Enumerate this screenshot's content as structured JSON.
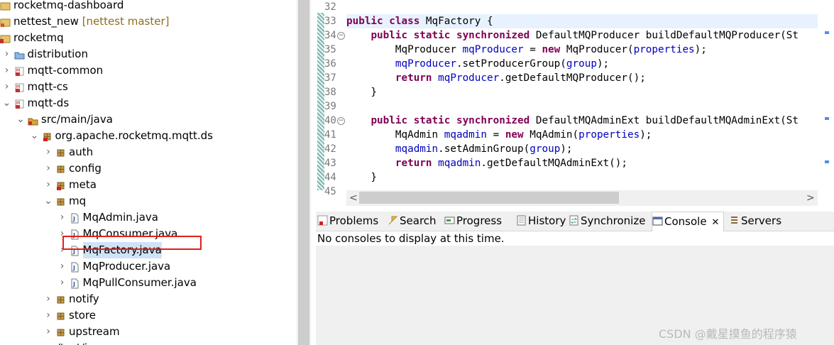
{
  "tree": {
    "rows": [
      {
        "label": "rocketmq-dashboard",
        "decor": "",
        "indent": 0,
        "twisty": "",
        "icon": "project"
      },
      {
        "label": "nettest_new",
        "decor": " [nettest master]",
        "indent": 0,
        "twisty": "",
        "icon": "git-project"
      },
      {
        "label": "rocketmq",
        "decor": "",
        "indent": 0,
        "twisty": "",
        "icon": "folder-project"
      },
      {
        "label": "distribution",
        "decor": "",
        "indent": 1,
        "twisty": ">",
        "icon": "folder"
      },
      {
        "label": "mqtt-common",
        "decor": "",
        "indent": 1,
        "twisty": ">",
        "icon": "maven-project"
      },
      {
        "label": "mqtt-cs",
        "decor": "",
        "indent": 1,
        "twisty": ">",
        "icon": "maven-project"
      },
      {
        "label": "mqtt-ds",
        "decor": "",
        "indent": 1,
        "twisty": "v",
        "icon": "maven-project"
      },
      {
        "label": "src/main/java",
        "decor": "",
        "indent": 2,
        "twisty": "v",
        "icon": "source-folder"
      },
      {
        "label": "org.apache.rocketmq.mqtt.ds",
        "decor": "",
        "indent": 3,
        "twisty": "v",
        "icon": "package-error"
      },
      {
        "label": "auth",
        "decor": "",
        "indent": 4,
        "twisty": ">",
        "icon": "package"
      },
      {
        "label": "config",
        "decor": "",
        "indent": 4,
        "twisty": ">",
        "icon": "package"
      },
      {
        "label": "meta",
        "decor": "",
        "indent": 4,
        "twisty": ">",
        "icon": "package-error"
      },
      {
        "label": "mq",
        "decor": "",
        "indent": 4,
        "twisty": "v",
        "icon": "package"
      },
      {
        "label": "MqAdmin.java",
        "decor": "",
        "indent": 5,
        "twisty": ">",
        "icon": "java-file"
      },
      {
        "label": "MqConsumer.java",
        "decor": "",
        "indent": 5,
        "twisty": ">",
        "icon": "java-file"
      },
      {
        "label": "MqFactory.java",
        "decor": "",
        "indent": 5,
        "twisty": ">",
        "icon": "java-file",
        "selected": true
      },
      {
        "label": "MqProducer.java",
        "decor": "",
        "indent": 5,
        "twisty": ">",
        "icon": "java-file"
      },
      {
        "label": "MqPullConsumer.java",
        "decor": "",
        "indent": 5,
        "twisty": ">",
        "icon": "java-file"
      },
      {
        "label": "notify",
        "decor": "",
        "indent": 4,
        "twisty": ">",
        "icon": "package"
      },
      {
        "label": "store",
        "decor": "",
        "indent": 4,
        "twisty": ">",
        "icon": "package"
      },
      {
        "label": "upstream",
        "decor": "",
        "indent": 4,
        "twisty": ">",
        "icon": "package"
      },
      {
        "label": "src/test/java",
        "decor": "",
        "indent": 2,
        "twisty": ">",
        "icon": "source-folder"
      }
    ]
  },
  "editor": {
    "lines": [
      {
        "n": "32",
        "html": ""
      },
      {
        "n": "33",
        "html": "<span class=\"kw\">public</span> <span class=\"kw\">class</span> MqFactory {",
        "current": true
      },
      {
        "n": "34",
        "html": "    <span class=\"kw\">public</span> <span class=\"kw\">static</span> <span class=\"kw\">synchronized</span> DefaultMQProducer buildDefaultMQProducer(St",
        "fold": true
      },
      {
        "n": "35",
        "html": "        MqProducer <span class=\"fld\">mqProducer</span> = <span class=\"kw\">new</span> MqProducer(<span class=\"fld\">properties</span>);"
      },
      {
        "n": "36",
        "html": "        <span class=\"fld\">mqProducer</span>.setProducerGroup(<span class=\"fld\">group</span>);"
      },
      {
        "n": "37",
        "html": "        <span class=\"kw\">return</span> <span class=\"fld\">mqProducer</span>.getDefaultMQProducer();"
      },
      {
        "n": "38",
        "html": "    }"
      },
      {
        "n": "39",
        "html": ""
      },
      {
        "n": "40",
        "html": "    <span class=\"kw\">public</span> <span class=\"kw\">static</span> <span class=\"kw\">synchronized</span> DefaultMQAdminExt buildDefaultMQAdminExt(St",
        "fold": true
      },
      {
        "n": "41",
        "html": "        MqAdmin <span class=\"fld\">mqadmin</span> = <span class=\"kw\">new</span> MqAdmin(<span class=\"fld\">properties</span>);"
      },
      {
        "n": "42",
        "html": "        <span class=\"fld\">mqadmin</span>.setAdminGroup(<span class=\"fld\">group</span>);"
      },
      {
        "n": "43",
        "html": "        <span class=\"kw\">return</span> <span class=\"fld\">mqadmin</span>.getDefaultMQAdminExt();"
      },
      {
        "n": "44",
        "html": "    }"
      },
      {
        "n": "45",
        "html": ""
      }
    ],
    "scroll_left_arrow": "<",
    "scroll_right_arrow": ">"
  },
  "console": {
    "tabs": [
      {
        "label": "Problems",
        "icon": "problems-icon"
      },
      {
        "label": "Search",
        "icon": "search-icon"
      },
      {
        "label": "Progress",
        "icon": "progress-icon"
      },
      {
        "label": "History",
        "icon": "history-icon"
      },
      {
        "label": "Synchronize",
        "icon": "synchronize-icon"
      },
      {
        "label": "Console",
        "icon": "console-icon",
        "active": true,
        "close": "✕"
      },
      {
        "label": "Servers",
        "icon": "servers-icon"
      }
    ],
    "message": "No consoles to display at this time."
  },
  "watermark": "CSDN @戴星摸鱼的程序猿",
  "colors": {
    "keyword": "#7f0055",
    "field": "#0000c0",
    "highlight": "#cfe3f5",
    "annotation": "#e0201b"
  }
}
